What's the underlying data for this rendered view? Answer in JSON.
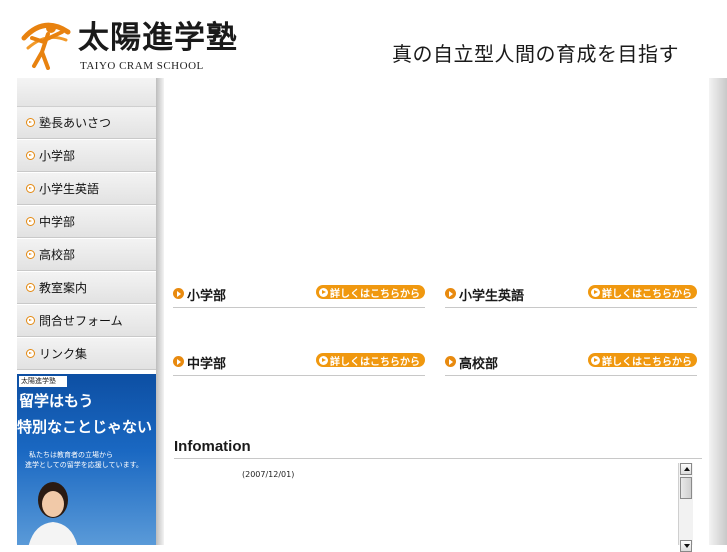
{
  "header": {
    "logo_jp": "太陽進学塾",
    "logo_en": "TAIYO CRAM SCHOOL",
    "tagline": "真の自立型人間の育成を目指す"
  },
  "sidebar": {
    "items": [
      {
        "label": "塾長あいさつ"
      },
      {
        "label": "小学部"
      },
      {
        "label": "小学生英語"
      },
      {
        "label": "中学部"
      },
      {
        "label": "高校部"
      },
      {
        "label": "教室案内"
      },
      {
        "label": "問合せフォーム"
      },
      {
        "label": "リンク集"
      }
    ],
    "banner": {
      "logo": "太陽進学塾",
      "headline_1": "留学はもう",
      "headline_2": "特別なことじゃない",
      "sub_1": "私たちは教育者の立場から",
      "sub_2": "進学としての留学を応援しています。"
    }
  },
  "sections": [
    {
      "title": "小学部",
      "link": "詳しくはこちらから"
    },
    {
      "title": "小学生英語",
      "link": "詳しくはこちらから"
    },
    {
      "title": "中学部",
      "link": "詳しくはこちらから"
    },
    {
      "title": "高校部",
      "link": "詳しくはこちらから"
    }
  ],
  "info": {
    "title": "Infomation",
    "date": "(2007/12/01)"
  },
  "colors": {
    "accent": "#f0980f",
    "banner_blue": "#1a68c2"
  }
}
